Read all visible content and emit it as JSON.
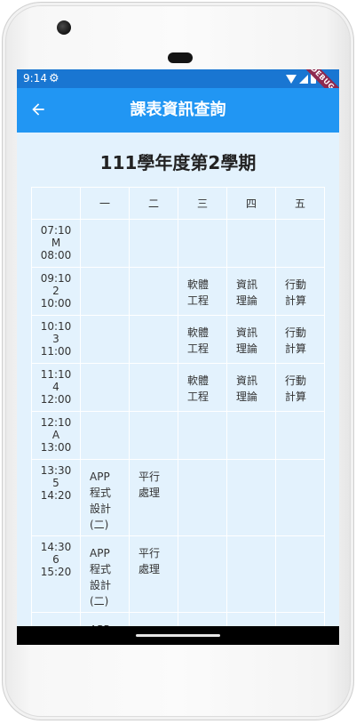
{
  "status_bar": {
    "time": "9:14",
    "settings_icon": "gear-icon",
    "debug_label": "DEBUG"
  },
  "app_bar": {
    "title": "課表資訊查詢",
    "back_icon": "arrow-left-icon"
  },
  "semester_title": "111學年度第2學期",
  "schedule": {
    "day_headers": [
      "",
      "一",
      "二",
      "三",
      "四",
      "五"
    ],
    "rows": [
      {
        "start": "07:10",
        "period": "M",
        "end": "08:00",
        "cells": [
          "",
          "",
          "",
          "",
          ""
        ],
        "height": 54
      },
      {
        "start": "09:10",
        "period": "2",
        "end": "10:00",
        "cells": [
          "",
          "",
          "軟體工程",
          "資訊理論",
          "行動計算"
        ],
        "height": 54
      },
      {
        "start": "10:10",
        "period": "3",
        "end": "11:00",
        "cells": [
          "",
          "",
          "軟體工程",
          "資訊理論",
          "行動計算"
        ],
        "height": 54
      },
      {
        "start": "11:10",
        "period": "4",
        "end": "12:00",
        "cells": [
          "",
          "",
          "軟體工程",
          "資訊理論",
          "行動計算"
        ],
        "height": 54
      },
      {
        "start": "12:10",
        "period": "A",
        "end": "13:00",
        "cells": [
          "",
          "",
          "",
          "",
          ""
        ],
        "height": 54
      },
      {
        "start": "13:30",
        "period": "5",
        "end": "14:20",
        "cells": [
          "APP程式設計(二)",
          "平行處理",
          "",
          "",
          ""
        ],
        "height": 86
      },
      {
        "start": "14:30",
        "period": "6",
        "end": "15:20",
        "cells": [
          "APP程式設計(二)",
          "平行處理",
          "",
          "",
          ""
        ],
        "height": 86
      },
      {
        "start": "",
        "period": "",
        "end": "",
        "cells": [
          "APP",
          "",
          "",
          "",
          ""
        ],
        "height": 86
      }
    ]
  },
  "colors": {
    "app_bar": "#2196f3",
    "status_bar": "#1976d2",
    "background": "#e3f2fd"
  }
}
